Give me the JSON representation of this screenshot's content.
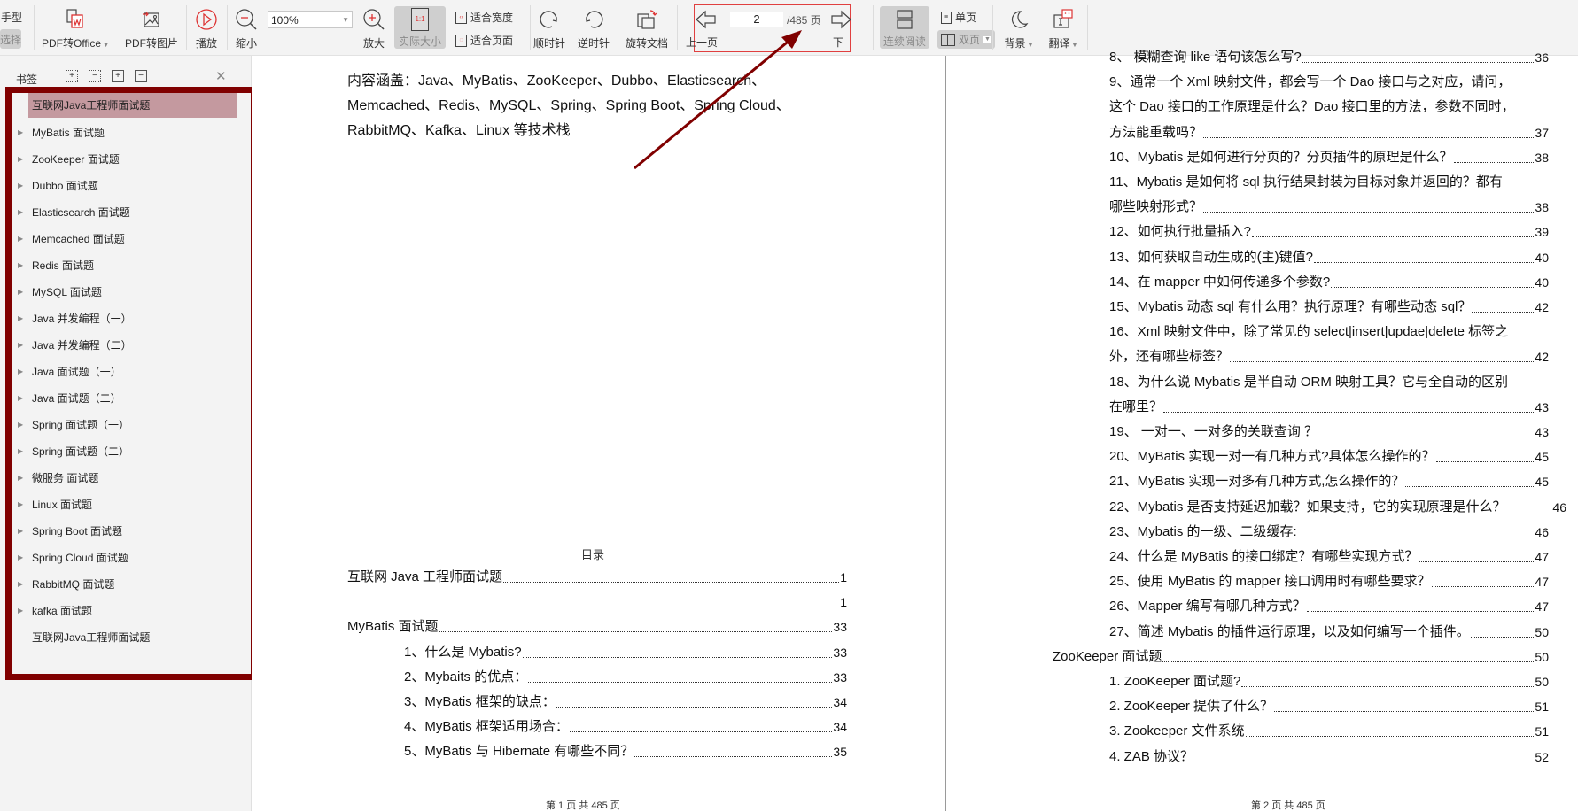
{
  "toolbar": {
    "hand_label": "手型",
    "select_label": "选择",
    "pdf_to_office": "PDF转Office",
    "pdf_to_image": "PDF转图片",
    "play": "播放",
    "zoom_out": "缩小",
    "zoom_value": "100%",
    "zoom_in": "放大",
    "actual_size": "实际大小",
    "actual_size_icon_text": "1:1",
    "fit_width": "适合宽度",
    "fit_page": "适合页面",
    "rotate_cw": "顺时针",
    "rotate_ccw": "逆时针",
    "rotate_doc": "旋转文档",
    "prev_page": "上一页",
    "current_page": "2",
    "total_pages": "/485 页",
    "next_page": "下一页",
    "continuous": "连续阅读",
    "single_page": "单页",
    "double_page": "双页",
    "background": "背景",
    "translate": "翻译"
  },
  "sidebar": {
    "title": "书签",
    "bookmarks": [
      {
        "label": "互联网Java工程师面试题",
        "expandable": false,
        "selected": true
      },
      {
        "label": "MyBatis 面试题",
        "expandable": true
      },
      {
        "label": "ZooKeeper 面试题",
        "expandable": true
      },
      {
        "label": "Dubbo 面试题",
        "expandable": true
      },
      {
        "label": "Elasticsearch 面试题",
        "expandable": true
      },
      {
        "label": "Memcached 面试题",
        "expandable": true
      },
      {
        "label": "Redis 面试题",
        "expandable": true
      },
      {
        "label": "MySQL 面试题",
        "expandable": true
      },
      {
        "label": "Java 并发编程（一）",
        "expandable": true
      },
      {
        "label": "Java 并发编程（二）",
        "expandable": true
      },
      {
        "label": "Java 面试题（一）",
        "expandable": true
      },
      {
        "label": "Java 面试题（二）",
        "expandable": true
      },
      {
        "label": "Spring 面试题（一）",
        "expandable": true
      },
      {
        "label": "Spring 面试题（二）",
        "expandable": true
      },
      {
        "label": "微服务 面试题",
        "expandable": true
      },
      {
        "label": "Linux 面试题",
        "expandable": true
      },
      {
        "label": "Spring Boot 面试题",
        "expandable": true
      },
      {
        "label": "Spring Cloud 面试题",
        "expandable": true
      },
      {
        "label": "RabbitMQ 面试题",
        "expandable": true
      },
      {
        "label": "kafka 面试题",
        "expandable": true
      },
      {
        "label": "互联网Java工程师面试题",
        "expandable": false
      }
    ]
  },
  "page1": {
    "intro": "内容涵盖：Java、MyBatis、ZooKeeper、Dubbo、Elasticsearch、Memcached、Redis、MySQL、Spring、Spring Boot、Spring Cloud、RabbitMQ、Kafka、Linux 等技术栈",
    "toc_title": "目录",
    "toc": [
      {
        "text": "互联网 Java 工程师面试题",
        "page": "1",
        "indent": 0
      },
      {
        "text": "",
        "page": "1",
        "indent": 0
      },
      {
        "text": "MyBatis 面试题",
        "page": "33",
        "indent": 0
      },
      {
        "text": "1、什么是 Mybatis?",
        "page": "33",
        "indent": 1
      },
      {
        "text": "2、Mybaits 的优点：",
        "page": "33",
        "indent": 1
      },
      {
        "text": "3、MyBatis 框架的缺点：",
        "page": "34",
        "indent": 1
      },
      {
        "text": "4、MyBatis 框架适用场合：",
        "page": "34",
        "indent": 1
      },
      {
        "text": "5、MyBatis 与 Hibernate 有哪些不同？",
        "page": "35",
        "indent": 1
      }
    ],
    "footer": "第 1 页 共 485 页"
  },
  "page2": {
    "toc": [
      {
        "lines": [
          "8、 模糊查询 like 语句该怎么写?"
        ],
        "page": "36",
        "indent": 1
      },
      {
        "lines": [
          "9、通常一个 Xml 映射文件，都会写一个 Dao 接口与之对应，请问，",
          "这个 Dao 接口的工作原理是什么？Dao 接口里的方法，参数不同时，",
          "方法能重载吗？"
        ],
        "page": "37",
        "indent": 1
      },
      {
        "lines": [
          "10、Mybatis 是如何进行分页的？分页插件的原理是什么？"
        ],
        "page": "38",
        "indent": 1
      },
      {
        "lines": [
          "11、Mybatis 是如何将 sql 执行结果封装为目标对象并返回的？都有",
          "哪些映射形式？"
        ],
        "page": "38",
        "indent": 1
      },
      {
        "lines": [
          "12、如何执行批量插入?"
        ],
        "page": "39",
        "indent": 1
      },
      {
        "lines": [
          "13、如何获取自动生成的(主)键值?"
        ],
        "page": "40",
        "indent": 1
      },
      {
        "lines": [
          "14、在 mapper 中如何传递多个参数?"
        ],
        "page": "40",
        "indent": 1
      },
      {
        "lines": [
          "15、Mybatis 动态 sql 有什么用？执行原理？有哪些动态 sql？"
        ],
        "page": "42",
        "indent": 1
      },
      {
        "lines": [
          "16、Xml 映射文件中，除了常见的 select|insert|updae|delete 标签之",
          "外，还有哪些标签？"
        ],
        "page": "42",
        "indent": 1
      },
      {
        "lines": [
          "18、为什么说 Mybatis 是半自动 ORM 映射工具？它与全自动的区别",
          "在哪里？"
        ],
        "page": "43",
        "indent": 1
      },
      {
        "lines": [
          "19、 一对一、一对多的关联查询 ？"
        ],
        "page": "43",
        "indent": 1
      },
      {
        "lines": [
          "20、MyBatis 实现一对一有几种方式?具体怎么操作的？"
        ],
        "page": "45",
        "indent": 1
      },
      {
        "lines": [
          "21、MyBatis 实现一对多有几种方式,怎么操作的？"
        ],
        "page": "45",
        "indent": 1
      },
      {
        "lines": [
          "22、Mybatis 是否支持延迟加载？如果支持，它的实现原理是什么？"
        ],
        "page": "46",
        "indent": 1,
        "nodots": true
      },
      {
        "lines": [
          "23、Mybatis 的一级、二级缓存:"
        ],
        "page": "46",
        "indent": 1
      },
      {
        "lines": [
          "24、什么是 MyBatis 的接口绑定？有哪些实现方式？"
        ],
        "page": "47",
        "indent": 1
      },
      {
        "lines": [
          "25、使用 MyBatis 的 mapper 接口调用时有哪些要求？"
        ],
        "page": "47",
        "indent": 1
      },
      {
        "lines": [
          "26、Mapper 编写有哪几种方式？"
        ],
        "page": "47",
        "indent": 1
      },
      {
        "lines": [
          "27、简述 Mybatis 的插件运行原理，以及如何编写一个插件。"
        ],
        "page": "50",
        "indent": 1
      },
      {
        "lines": [
          "ZooKeeper 面试题"
        ],
        "page": "50",
        "indent": 0
      },
      {
        "lines": [
          "1. ZooKeeper 面试题?"
        ],
        "page": "50",
        "indent": 1
      },
      {
        "lines": [
          "2. ZooKeeper 提供了什么？"
        ],
        "page": "51",
        "indent": 1
      },
      {
        "lines": [
          "3. Zookeeper 文件系统"
        ],
        "page": "51",
        "indent": 1
      },
      {
        "lines": [
          "4. ZAB 协议？"
        ],
        "page": "52",
        "indent": 1
      }
    ],
    "footer": "第 2 页 共 485 页"
  },
  "colors": {
    "annotation_frame": "#800000",
    "nav_highlight": "#e04040",
    "selected_bookmark": "#c4999f",
    "toolbar_bg": "#f3f3f3"
  }
}
